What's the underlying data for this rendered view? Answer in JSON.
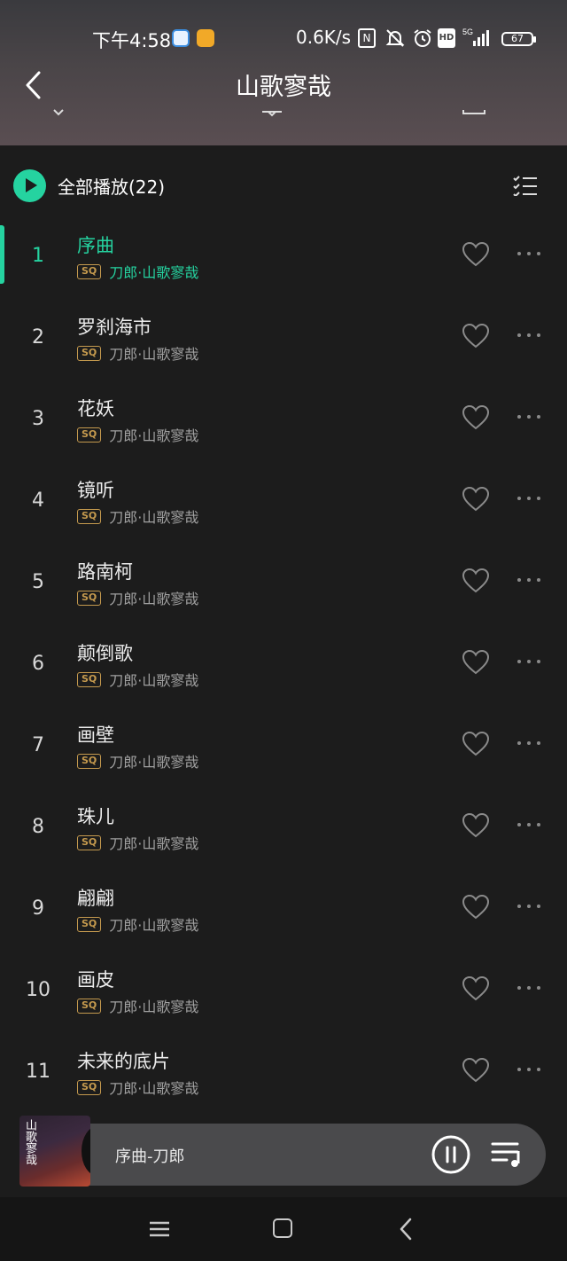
{
  "status_bar": {
    "time": "下午4:58",
    "net_speed": "0.6K/s",
    "nfc_label": "N",
    "hd_label": "HD",
    "network_label": "5G",
    "battery": "67",
    "icons": [
      "nfc-icon",
      "mute-icon",
      "alarm-icon",
      "hd-icon",
      "signal-icon",
      "battery-icon"
    ]
  },
  "header": {
    "title": "山歌寥哉"
  },
  "play_all": {
    "label": "全部播放(22)"
  },
  "songs": [
    {
      "num": "1",
      "title": "序曲",
      "quality": "SQ",
      "artist": "刀郎·山歌寥哉",
      "playing": true
    },
    {
      "num": "2",
      "title": "罗刹海市",
      "quality": "SQ",
      "artist": "刀郎·山歌寥哉",
      "playing": false
    },
    {
      "num": "3",
      "title": "花妖",
      "quality": "SQ",
      "artist": "刀郎·山歌寥哉",
      "playing": false
    },
    {
      "num": "4",
      "title": "镜听",
      "quality": "SQ",
      "artist": "刀郎·山歌寥哉",
      "playing": false
    },
    {
      "num": "5",
      "title": "路南柯",
      "quality": "SQ",
      "artist": "刀郎·山歌寥哉",
      "playing": false
    },
    {
      "num": "6",
      "title": "颠倒歌",
      "quality": "SQ",
      "artist": "刀郎·山歌寥哉",
      "playing": false
    },
    {
      "num": "7",
      "title": "画壁",
      "quality": "SQ",
      "artist": "刀郎·山歌寥哉",
      "playing": false
    },
    {
      "num": "8",
      "title": "珠儿",
      "quality": "SQ",
      "artist": "刀郎·山歌寥哉",
      "playing": false
    },
    {
      "num": "9",
      "title": "翩翩",
      "quality": "SQ",
      "artist": "刀郎·山歌寥哉",
      "playing": false
    },
    {
      "num": "10",
      "title": "画皮",
      "quality": "SQ",
      "artist": "刀郎·山歌寥哉",
      "playing": false
    },
    {
      "num": "11",
      "title": "未来的底片",
      "quality": "SQ",
      "artist": "刀郎·山歌寥哉",
      "playing": false
    }
  ],
  "mini_player": {
    "now_playing": "序曲-刀郎",
    "cover_text": "山歌寥哉"
  },
  "colors": {
    "accent": "#25d3a0",
    "background": "#1c1c1c",
    "sq_badge": "#c59a4e"
  }
}
